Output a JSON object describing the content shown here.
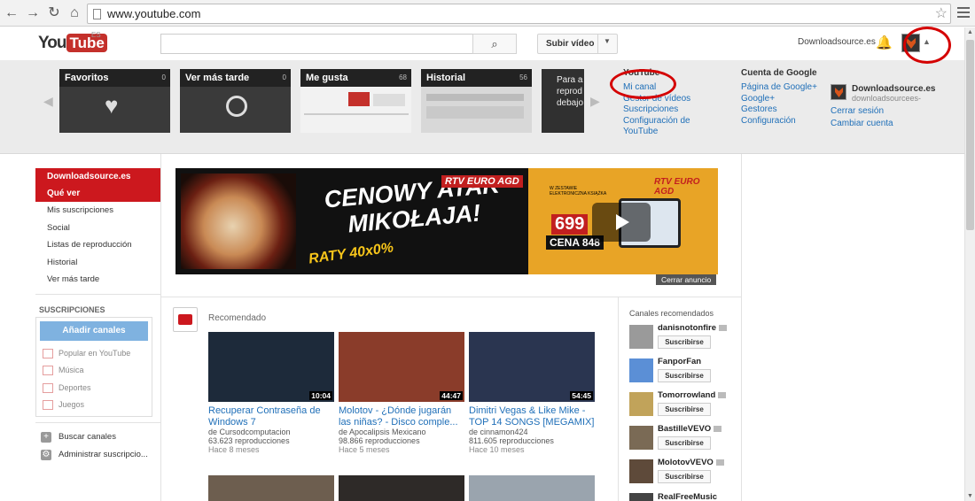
{
  "browser": {
    "url": "www.youtube.com",
    "back_icon": "←",
    "forward_icon": "→",
    "reload_icon": "↻",
    "home_icon": "⌂",
    "star_icon": "☆"
  },
  "masthead": {
    "logo_you": "You",
    "logo_tube": "Tube",
    "country": "ES",
    "search_placeholder": "",
    "search_icon": "⌕",
    "upload_label": "Subir vídeo",
    "upload_caret": "▼",
    "account_name": "Downloadsource.es",
    "bell_icon": "🔔",
    "account_caret": "▲"
  },
  "panel": {
    "tiles": [
      {
        "title": "Favoritos",
        "count": "0"
      },
      {
        "title": "Ver más tarde",
        "count": "0"
      },
      {
        "title": "Me gusta",
        "count": "68"
      },
      {
        "title": "Historial",
        "count": "56"
      }
    ],
    "partial_tile_text": "Para a reprod debajo",
    "youtube_col": {
      "head": "YouTube",
      "links": [
        "Mi canal",
        "Gestor de vídeos",
        "Suscripciones",
        "Configuración de YouTube"
      ]
    },
    "google_col": {
      "head": "Cuenta de Google",
      "links": [
        "Página de Google+",
        "Google+",
        "Gestores",
        "Configuración"
      ]
    },
    "account": {
      "name": "Downloadsource.es",
      "email": "downloadsourcees-",
      "signout": "Cerrar sesión",
      "switch": "Cambiar cuenta"
    }
  },
  "guide": {
    "channel": "Downloadsource.es",
    "what_to_watch": "Qué ver",
    "items": [
      "Mis suscripciones",
      "Social",
      "Listas de reproducción",
      "Historial",
      "Ver más tarde"
    ],
    "subs_heading": "SUSCRIPCIONES",
    "add_channels": "Añadir canales",
    "subs": [
      "Popular en YouTube",
      "Música",
      "Deportes",
      "Juegos"
    ],
    "bottom": [
      "Buscar canales",
      "Administrar suscripcio..."
    ]
  },
  "banner": {
    "headline": "CENOWY ATAK MIKOŁAJA!",
    "raty": "RATY 40x0%",
    "brand": "RTV EURO AGD",
    "brand2": "RTV EURO AGD",
    "promo": "W ZESTAWIE ELEKTRONICZNA KSIĄŻKA",
    "price": "699",
    "cena": "CENA 848",
    "close_ad": "Cerrar anuncio"
  },
  "feed": {
    "title": "Recomendado",
    "videos": [
      {
        "title": "Recuperar Contraseña de Windows 7",
        "author": "de Cursodcomputacion",
        "views": "63.623 reproducciones",
        "age": "Hace 8 meses",
        "duration": "10:04",
        "bg": "#1d2a3a"
      },
      {
        "title": "Molotov - ¿Dónde jugarán las niñas? - Disco comple...",
        "author": "de Apocalipsis Mexicano",
        "views": "98.866 reproducciones",
        "age": "Hace 5 meses",
        "duration": "44:47",
        "bg": "#8a3c2a"
      },
      {
        "title": "Dimitri Vegas & Like Mike - TOP 14 SONGS [MEGAMIX]",
        "author": "de cinnamon424",
        "views": "811.605 reproducciones",
        "age": "Hace 10 meses",
        "duration": "54:45",
        "bg": "#2a3550"
      }
    ]
  },
  "channels": {
    "heading": "Canales recomendados",
    "subscribe_label": "Suscribirse",
    "list": [
      {
        "name": "danisnotonfire",
        "color": "#9a9a9a"
      },
      {
        "name": "FanporFan",
        "color": "#5b8fd6"
      },
      {
        "name": "Tomorrowland",
        "color": "#c1a35a"
      },
      {
        "name": "BastilleVEVO",
        "color": "#7a6a55"
      },
      {
        "name": "MolotovVEVO",
        "color": "#5e4a3a"
      },
      {
        "name": "RealFreeMusic",
        "color": "#444444"
      }
    ]
  }
}
